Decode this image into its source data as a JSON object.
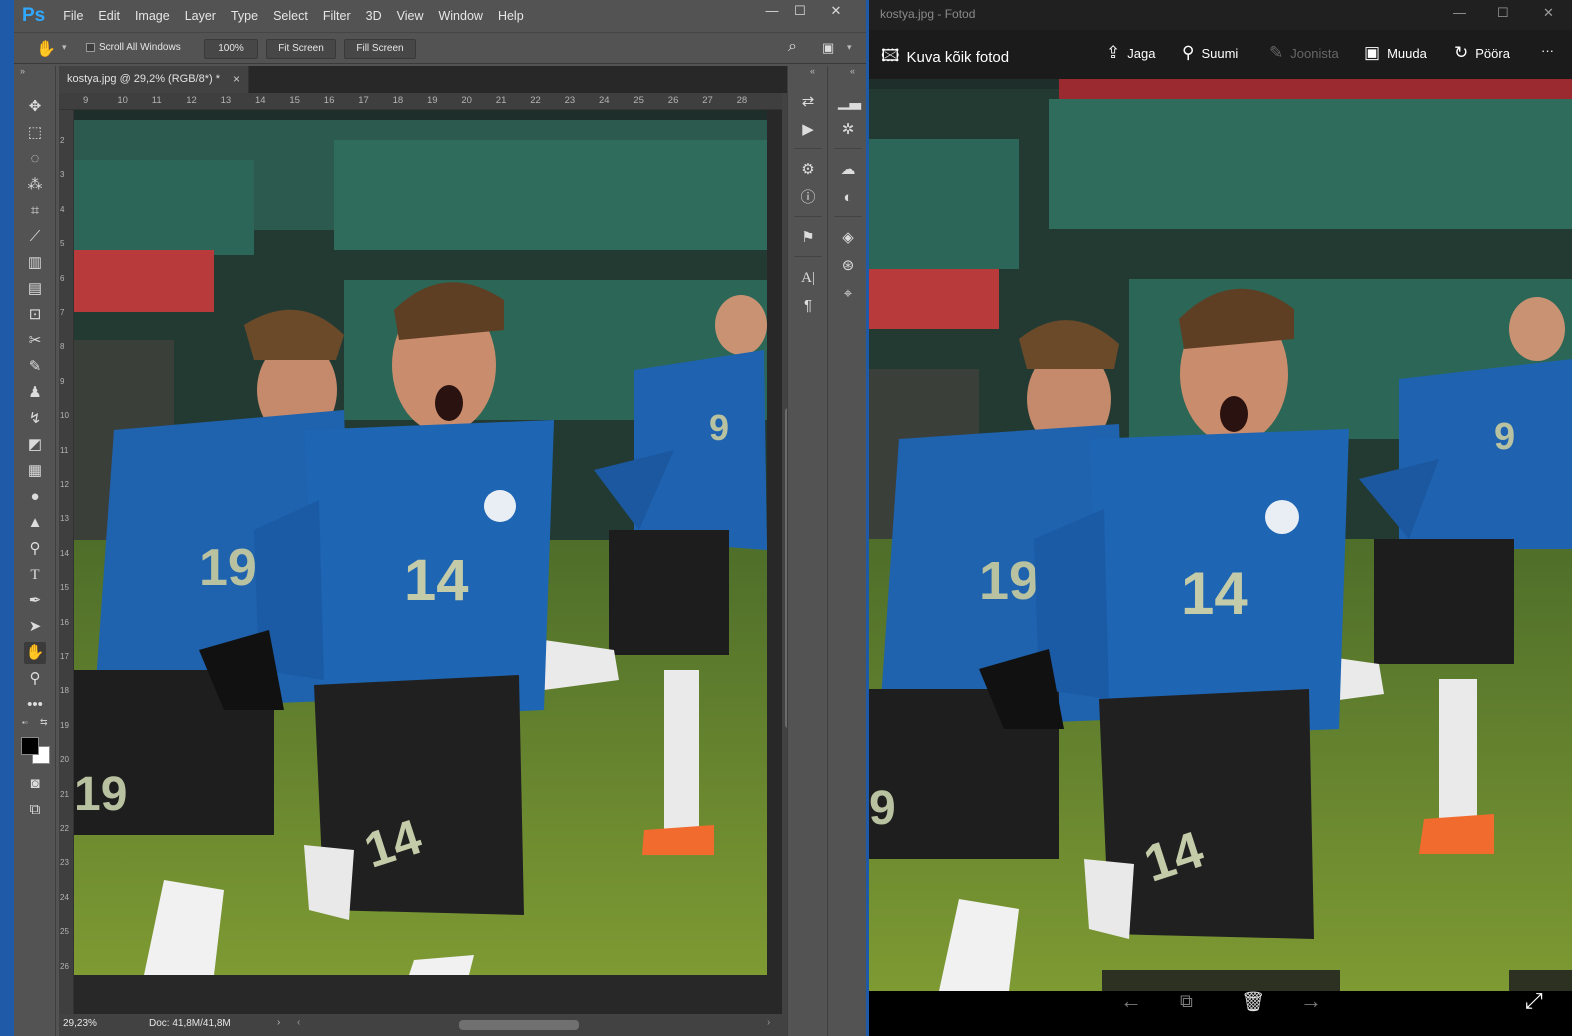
{
  "photoshop": {
    "logo": "Ps",
    "menu": [
      "File",
      "Edit",
      "Image",
      "Layer",
      "Type",
      "Select",
      "Filter",
      "3D",
      "View",
      "Window",
      "Help"
    ],
    "window_controls": {
      "minimize": "—",
      "maximize": "☐",
      "close": "✕"
    },
    "options": {
      "scroll_all_windows": "Scroll All Windows",
      "zoom_button": "100%",
      "fit_screen": "Fit Screen",
      "fill_screen": "Fill Screen"
    },
    "doc_tab": {
      "title": "kostya.jpg @ 29,2% (RGB/8*) *",
      "close": "×"
    },
    "ruler_top": [
      "9",
      "10",
      "11",
      "12",
      "13",
      "14",
      "15",
      "16",
      "17",
      "18",
      "19",
      "20",
      "21",
      "22",
      "23",
      "24",
      "25",
      "26",
      "27",
      "28"
    ],
    "ruler_left": [
      "2",
      "3",
      "4",
      "5",
      "6",
      "7",
      "8",
      "9",
      "10",
      "11",
      "12",
      "13",
      "14",
      "15",
      "16",
      "17",
      "18",
      "19",
      "20",
      "21",
      "22",
      "23",
      "24",
      "25",
      "26"
    ],
    "status": {
      "zoom": "29,23%",
      "doc": "Doc: 41,8M/41,8M"
    },
    "tools": [
      "move-icon",
      "marquee-icon",
      "lasso-icon",
      "magic-wand-icon",
      "crop-icon",
      "eyedropper-icon",
      "healing-icon",
      "patch-icon",
      "frame-icon",
      "brush-icon",
      "stamp-icon",
      "history-brush-icon",
      "eraser-icon",
      "gradient-icon",
      "blur-icon",
      "sharpen-icon",
      "dodge-icon",
      "type-icon",
      "pen-icon",
      "path-select-icon",
      "hand-icon",
      "zoom-icon",
      "more-icon"
    ]
  },
  "fotod": {
    "title": "kostya.jpg - Fotod",
    "window_controls": {
      "minimize": "—",
      "maximize": "☐",
      "close": "✕"
    },
    "view_all": "Kuva kõik fotod",
    "commands": {
      "share": "Jaga",
      "zoom": "Suumi",
      "draw": "Joonista",
      "edit": "Muuda",
      "rotate": "Pööra",
      "more": "···"
    }
  },
  "colors": {
    "ps_bg": "#535353",
    "ps_accent": "#31a8ff",
    "jersey_blue": "#1c5fa8",
    "pitch_green": "#6d8a2a",
    "stand_green": "#2c6a58"
  }
}
